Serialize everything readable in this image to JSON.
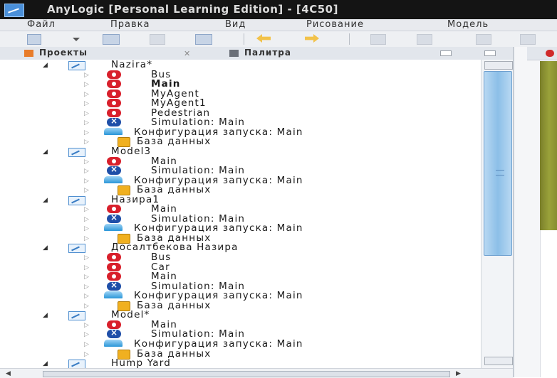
{
  "window": {
    "title": "AnyLogic [Personal Learning Edition] - [4C50]"
  },
  "menu": [
    "Файл",
    "Правка",
    "Вид",
    "Рисование",
    "Модель"
  ],
  "tabs": {
    "projects": "Проекты",
    "close": "✕",
    "palette": "Палитра"
  },
  "tree": [
    {
      "kind": "model",
      "label": "Nazira*",
      "expanded": true
    },
    {
      "kind": "agent",
      "label": "Bus",
      "child": true
    },
    {
      "kind": "agent",
      "label": "Main",
      "child": true,
      "bold": true
    },
    {
      "kind": "agent",
      "label": "MyAgent",
      "child": true
    },
    {
      "kind": "agent",
      "label": "MyAgent1",
      "child": true
    },
    {
      "kind": "agent",
      "label": "Pedestrian",
      "child": true
    },
    {
      "kind": "sim",
      "label": "Simulation: Main",
      "child": true
    },
    {
      "kind": "run",
      "label": "Конфигурация запуска: Main",
      "child": true
    },
    {
      "kind": "db",
      "label": "База данных",
      "child": true
    },
    {
      "kind": "model",
      "label": "Model3",
      "expanded": true
    },
    {
      "kind": "agent",
      "label": "Main",
      "child": true
    },
    {
      "kind": "sim",
      "label": "Simulation: Main",
      "child": true
    },
    {
      "kind": "run",
      "label": "Конфигурация запуска: Main",
      "child": true
    },
    {
      "kind": "db",
      "label": "База данных",
      "child": true
    },
    {
      "kind": "model",
      "label": "Назира1",
      "expanded": true
    },
    {
      "kind": "agent",
      "label": "Main",
      "child": true
    },
    {
      "kind": "sim",
      "label": "Simulation: Main",
      "child": true
    },
    {
      "kind": "run",
      "label": "Конфигурация запуска: Main",
      "child": true
    },
    {
      "kind": "db",
      "label": "База данных",
      "child": true
    },
    {
      "kind": "model",
      "label": "Досалтбекова Назира",
      "expanded": true
    },
    {
      "kind": "agent",
      "label": "Bus",
      "child": true
    },
    {
      "kind": "agent",
      "label": "Car",
      "child": true
    },
    {
      "kind": "agent",
      "label": "Main",
      "child": true
    },
    {
      "kind": "sim",
      "label": "Simulation: Main",
      "child": true
    },
    {
      "kind": "run",
      "label": "Конфигурация запуска: Main",
      "child": true
    },
    {
      "kind": "db",
      "label": "База данных",
      "child": true
    },
    {
      "kind": "model",
      "label": "Model*",
      "expanded": true
    },
    {
      "kind": "agent",
      "label": "Main",
      "child": true
    },
    {
      "kind": "sim",
      "label": "Simulation: Main",
      "child": true
    },
    {
      "kind": "run",
      "label": "Конфигурация запуска: Main",
      "child": true
    },
    {
      "kind": "db",
      "label": "База данных",
      "child": true
    },
    {
      "kind": "model",
      "label": "Hump Yard",
      "expanded": true
    }
  ],
  "icons": {
    "model": "model-icon",
    "agent": "agent-type-icon",
    "sim": "simulation-experiment-icon",
    "run": "run-configuration-icon",
    "db": "database-icon"
  },
  "colors": {
    "agent": "#d8202c",
    "sim": "#1f4fa8",
    "db": "#f0b020",
    "scroll_thumb": "#8cbfe8"
  }
}
